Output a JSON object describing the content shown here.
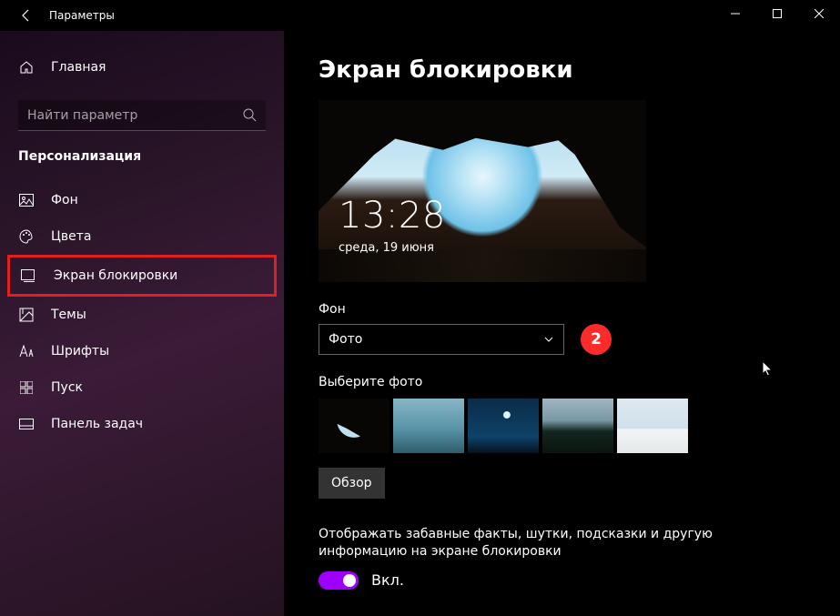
{
  "app_title": "Параметры",
  "home_label": "Главная",
  "search_placeholder": "Найти параметр",
  "category": "Персонализация",
  "sidebar": {
    "items": [
      {
        "label": "Фон"
      },
      {
        "label": "Цвета"
      },
      {
        "label": "Экран блокировки"
      },
      {
        "label": "Темы"
      },
      {
        "label": "Шрифты"
      },
      {
        "label": "Пуск"
      },
      {
        "label": "Панель задач"
      }
    ]
  },
  "page_heading": "Экран блокировки",
  "preview_time": "13:28",
  "preview_date": "среда, 19 июня",
  "background_label": "Фон",
  "background_value": "Фото",
  "annotation_badge": "2",
  "choose_photo_label": "Выберите фото",
  "browse_label": "Обзор",
  "fun_facts_label": "Отображать забавные факты, шутки, подсказки и другую информацию на экране блокировки",
  "toggle_state": "Вкл."
}
